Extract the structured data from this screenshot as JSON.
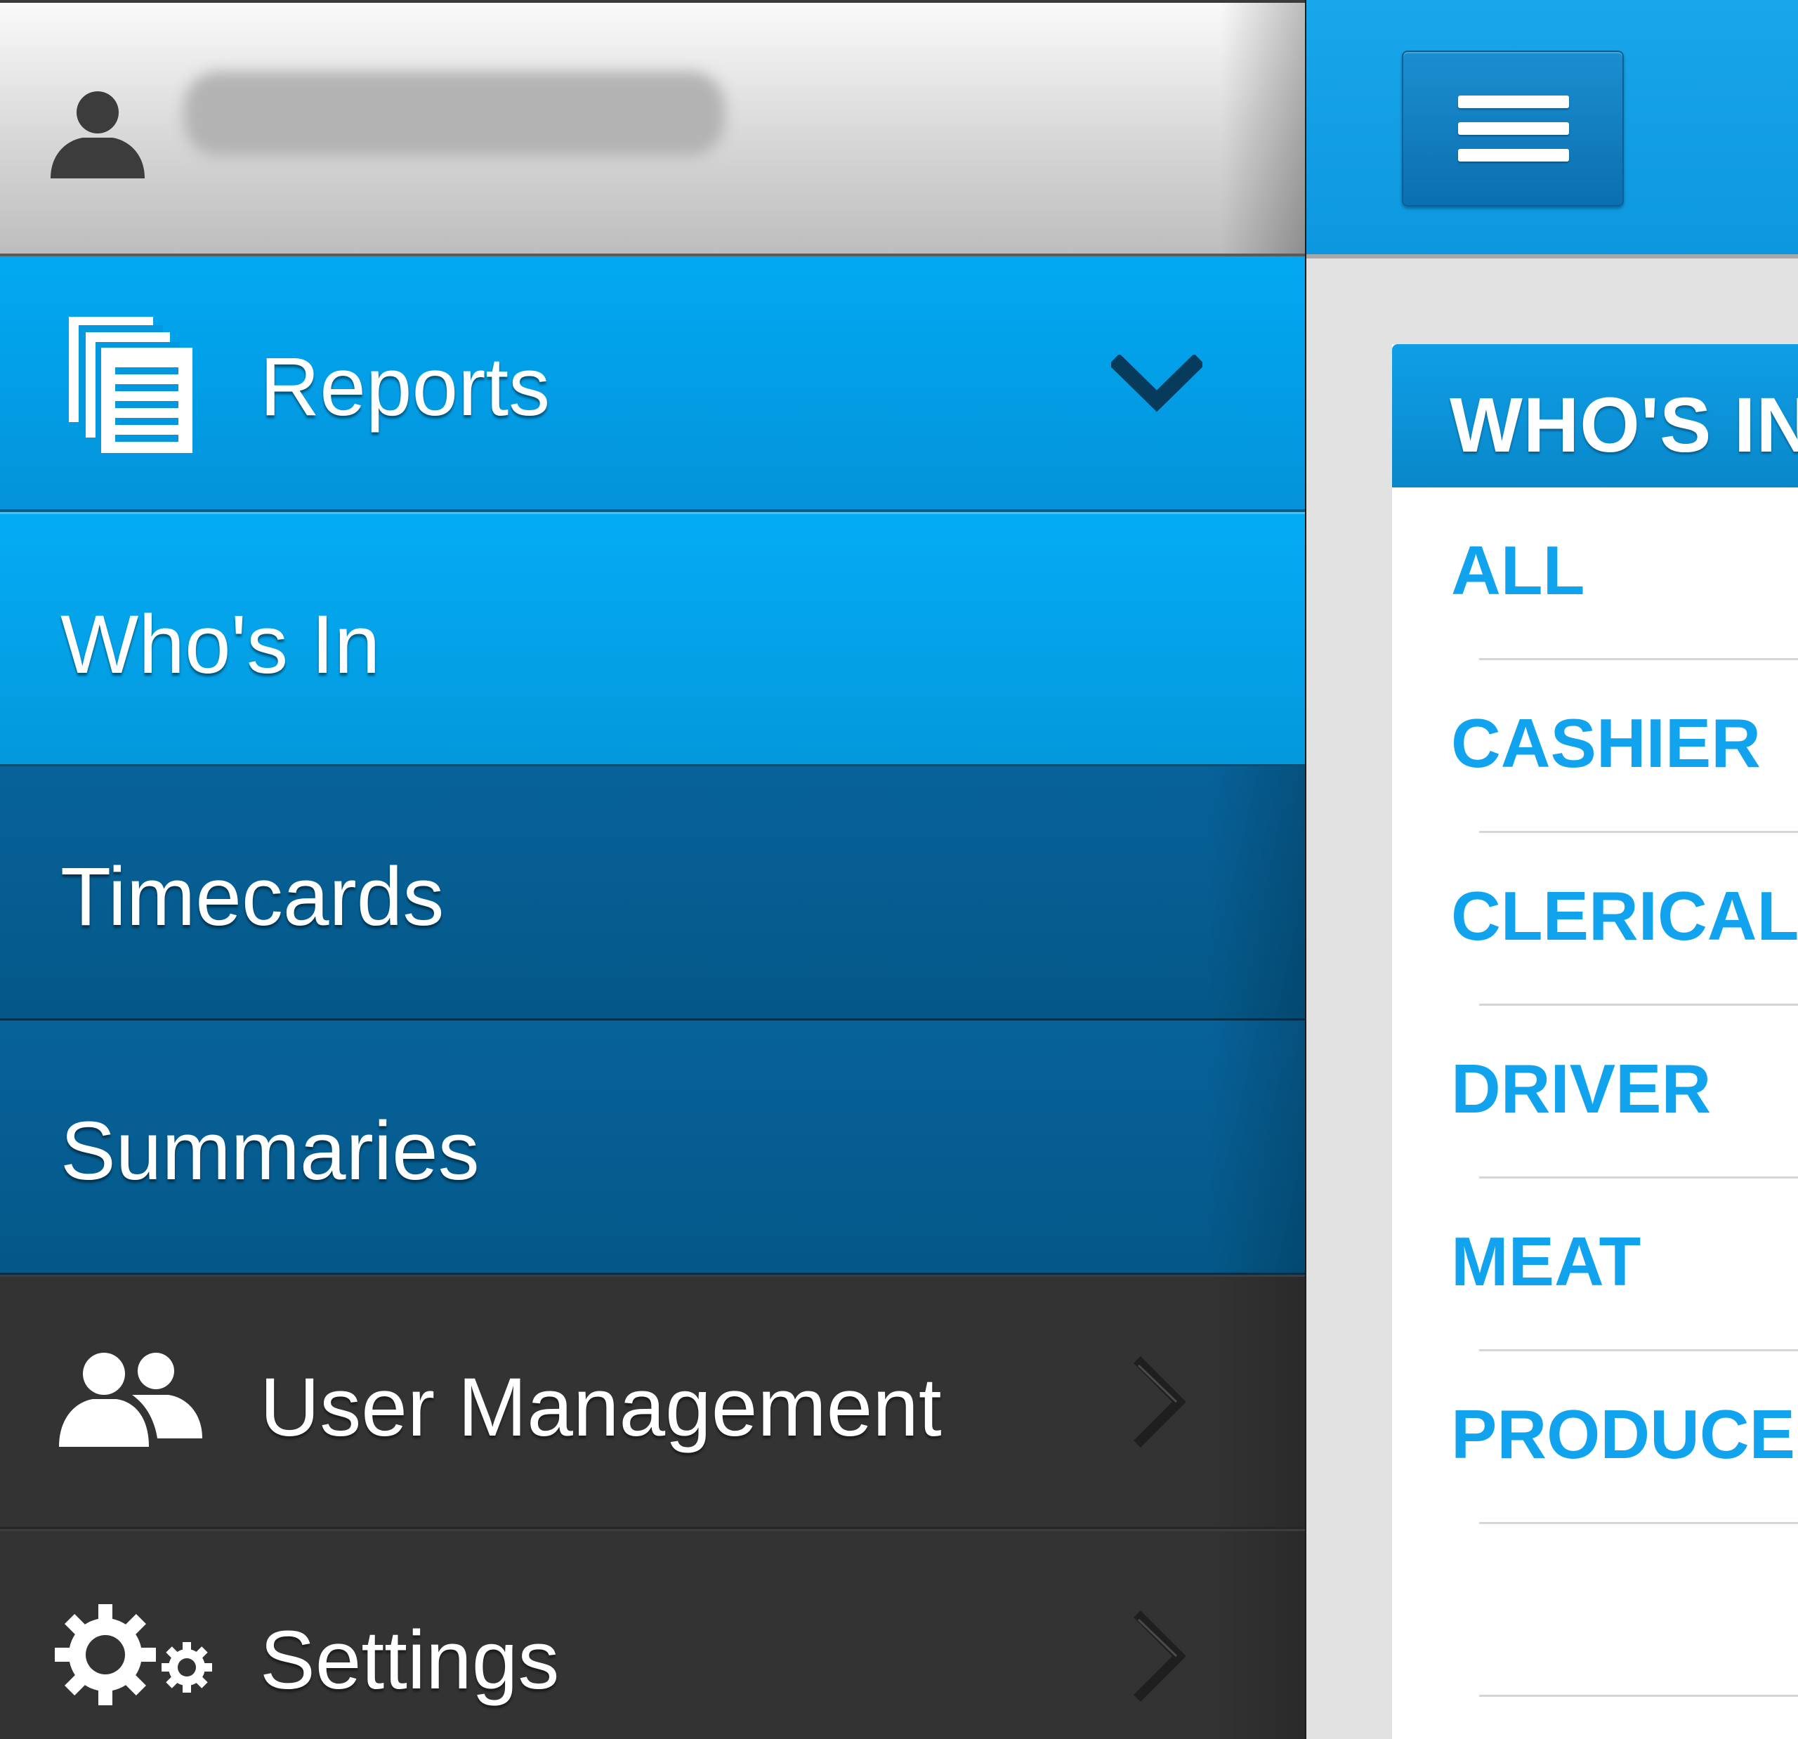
{
  "drawer": {
    "profile": {
      "username": "",
      "avatar_icon": "user-avatar-icon"
    },
    "items": [
      {
        "label": "Reports",
        "icon": "reports-icon",
        "indicator": "chevron-down-icon",
        "state": "expanded"
      },
      {
        "label": "Who's In",
        "state": "selected"
      },
      {
        "label": "Timecards"
      },
      {
        "label": "Summaries"
      },
      {
        "label": "User Management",
        "icon": "users-icon",
        "indicator": "chevron-right-icon"
      },
      {
        "label": "Settings",
        "icon": "gears-icon",
        "indicator": "chevron-right-icon"
      }
    ]
  },
  "main": {
    "menu_button_icon": "hamburger-menu-icon",
    "panel": {
      "title": "WHO'S IN",
      "categories": [
        "ALL",
        "CASHIER",
        "CLERICAL",
        "DRIVER",
        "MEAT",
        "PRODUCE"
      ]
    }
  },
  "colors": {
    "accent_blue": "#02a9f2",
    "submenu_blue": "#07629a",
    "drawer_dark": "#333333",
    "category_text": "#12a3ee"
  }
}
